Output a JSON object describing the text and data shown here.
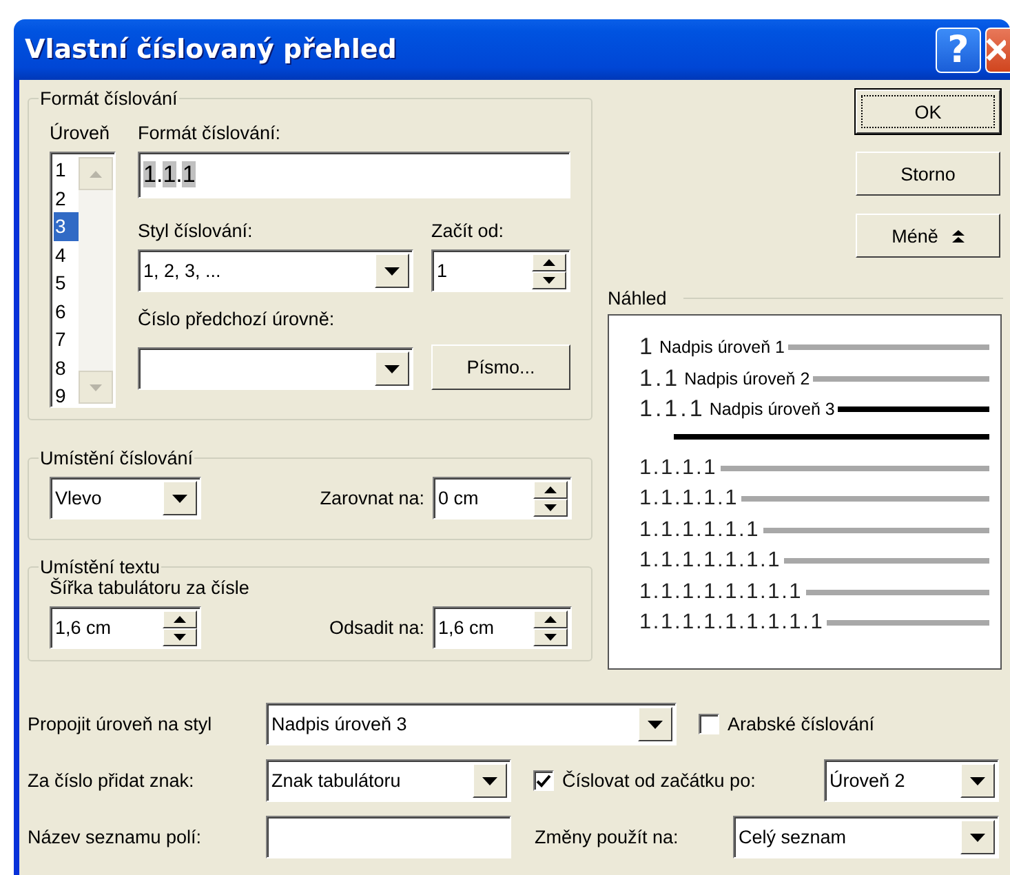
{
  "window": {
    "title": "Vlastní číslovaný přehled",
    "help": "?"
  },
  "number_format": {
    "legend": "Formát číslování",
    "levels_label": {
      "text": "Úroveň"
    },
    "levels": [
      {
        "label": "1",
        "selected": false
      },
      {
        "label": "2",
        "selected": false
      },
      {
        "label": "3",
        "selected": true
      },
      {
        "label": "4",
        "selected": false
      },
      {
        "label": "5",
        "selected": false
      },
      {
        "label": "6",
        "selected": false
      },
      {
        "label": "7",
        "selected": false
      },
      {
        "label": "8",
        "selected": false
      },
      {
        "label": "9",
        "selected": false
      }
    ],
    "format_label": {
      "text": "Formát číslování:"
    },
    "format_value": "1.1.1",
    "style_label": {
      "text": "Styl číslování:"
    },
    "style_value": "1, 2, 3, ...",
    "start_label": {
      "text": "Začít od:"
    },
    "start_value": "1",
    "previous_label": {
      "text": "Číslo předchozí úrovně:"
    },
    "font_button": {
      "text": "Písmo..."
    }
  },
  "number_position": {
    "legend": {
      "text": "Umístění číslování"
    },
    "alignment": "Vlevo",
    "align_label": {
      "text": "Zarovnat na:"
    },
    "align_value": "0 cm"
  },
  "text_position": {
    "legend": {
      "text": "Umístění textu"
    },
    "tab_label": {
      "text": "Šířka tabulátoru za čísle"
    },
    "tab_value": "1,6 cm",
    "indent_label": {
      "text": "Odsadit na:"
    },
    "indent_value": "1,6 cm"
  },
  "buttons": [
    {
      "text": "OK",
      "kind": "default"
    },
    {
      "text": "Storno",
      "kind": "plain"
    },
    {
      "text": "Méně",
      "kind": "collapse"
    }
  ],
  "preview": {
    "label": "Náhled",
    "lines": [
      {
        "number": "1",
        "label": "Nadpis úroveň 1",
        "selected": false
      },
      {
        "number": "1.1",
        "label": "Nadpis úroveň 2",
        "selected": false
      },
      {
        "number": "1.1.1",
        "label": "Nadpis úroveň 3",
        "selected": true
      },
      {
        "number": "1.1.1.1",
        "selected": false
      },
      {
        "number": "1.1.1.1.1",
        "selected": false
      },
      {
        "number": "1.1.1.1.1.1",
        "selected": false
      },
      {
        "number": "1.1.1.1.1.1.1",
        "selected": false
      },
      {
        "number": "1.1.1.1.1.1.1.1",
        "selected": false
      },
      {
        "number": "1.1.1.1.1.1.1.1.1",
        "selected": false
      }
    ]
  },
  "link_style": {
    "label": {
      "text": "Propojit úroveň na styl"
    },
    "value": "Nadpis úroveň 3"
  },
  "arabic": {
    "label": {
      "text": "Arabské číslování"
    },
    "checked": false
  },
  "follow_number": {
    "label": {
      "text": "Za číslo přidat znak:"
    },
    "value": "Znak tabulátoru"
  },
  "restart": {
    "label": {
      "text": "Číslovat od začátku po:"
    },
    "checked": true,
    "value": "Úroveň 2"
  },
  "listnum": {
    "label": {
      "text": "Název seznamu polí:"
    }
  },
  "apply_to": {
    "label": {
      "text": "Změny použít na:"
    },
    "value": "Celý seznam"
  }
}
